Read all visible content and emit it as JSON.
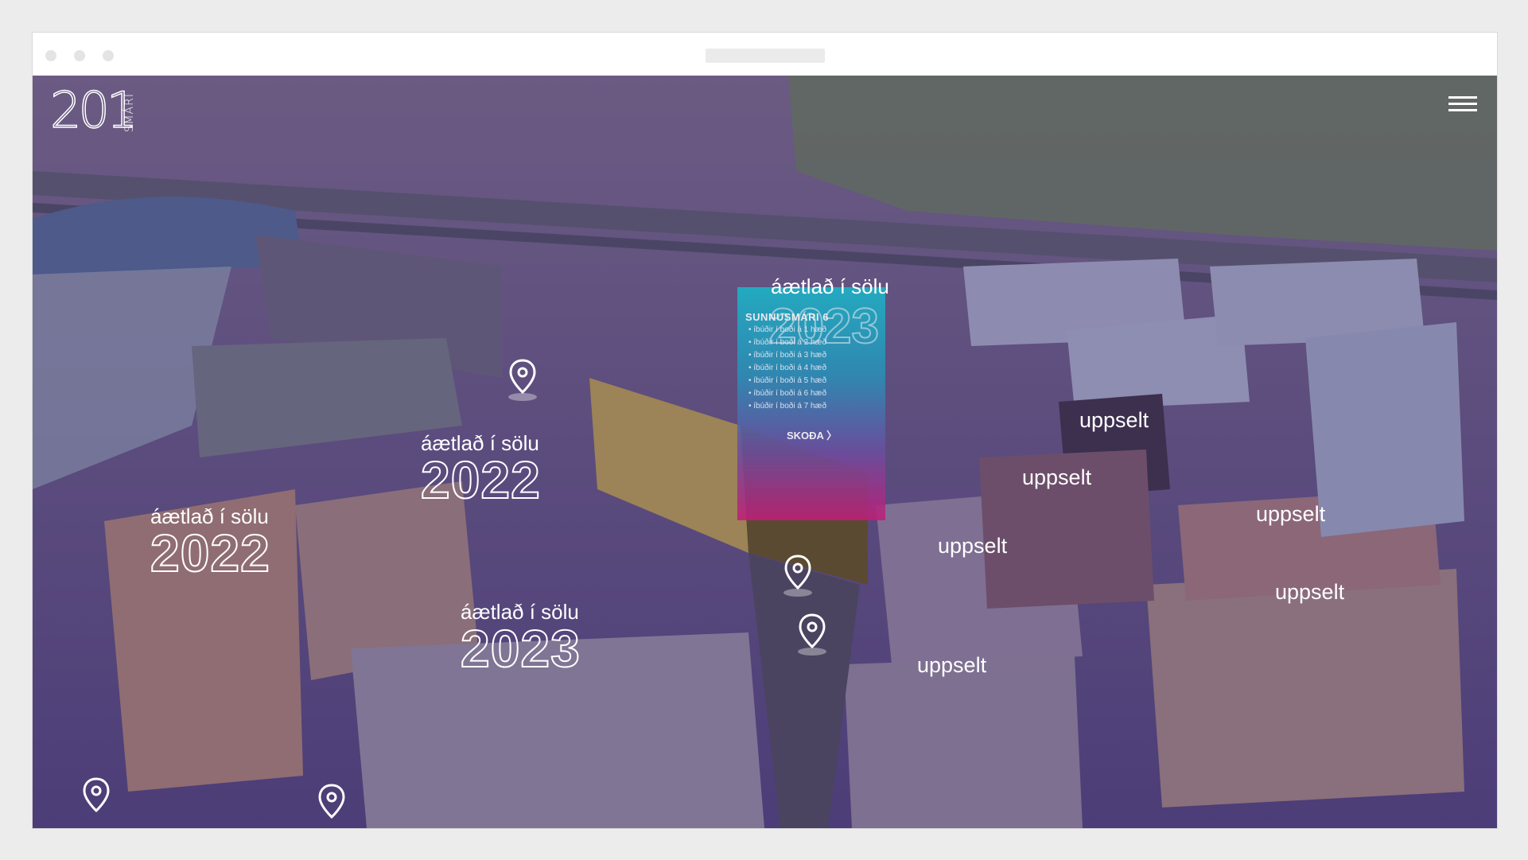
{
  "logo": {
    "number": "201",
    "word": "SMÁRI"
  },
  "labels": {
    "a": {
      "title": "áætlað í sölu",
      "year": "2022"
    },
    "b": {
      "title": "áætlað í sölu",
      "year": "2022"
    },
    "c": {
      "title": "áætlað í sölu",
      "year": "2023"
    }
  },
  "panel": {
    "title": "áætlað í sölu",
    "year": "2023",
    "heading": "SUNNUSMÁRI 6",
    "items": [
      "íbúðir í boði á 1 hæð",
      "íbúðir í boði á 2 hæð",
      "íbúðir í boði á 3 hæð",
      "íbúðir í boði á 4 hæð",
      "íbúðir í boði á 5 hæð",
      "íbúðir í boði á 6 hæð",
      "íbúðir í boði á 7 hæð"
    ],
    "cta": "SKOÐA 〉"
  },
  "sold": [
    "uppselt",
    "uppselt",
    "uppselt",
    "uppselt",
    "uppselt",
    "uppselt"
  ],
  "icons": {
    "menu": "hamburger-icon",
    "pin": "map-pin-icon"
  },
  "colors": {
    "overlay": "#5b4a86",
    "panel_top": "#1bb6c9",
    "panel_bottom": "#c01e77",
    "text": "#ffffff"
  }
}
